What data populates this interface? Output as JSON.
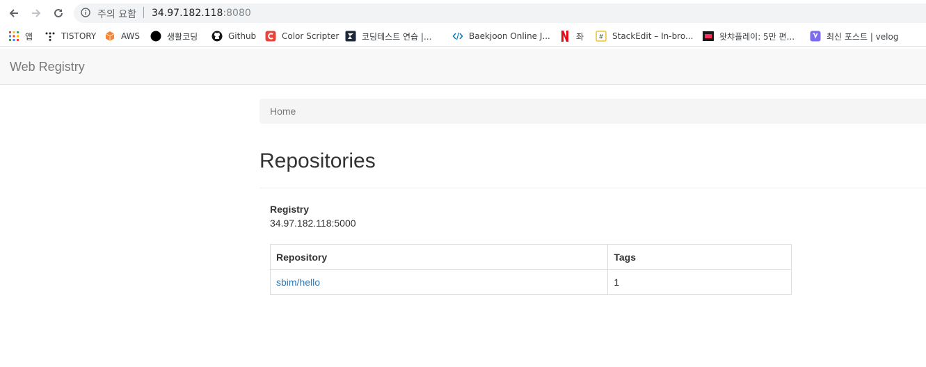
{
  "browser": {
    "security_warning": "주의 요함",
    "url_host": "34.97.182.118",
    "url_port": ":8080",
    "bookmarks": [
      {
        "label": "앱",
        "icon": "apps-grid-icon"
      },
      {
        "label": "TISTORY",
        "icon": "tistory-icon"
      },
      {
        "label": "AWS",
        "icon": "aws-cube-icon"
      },
      {
        "label": "생활코딩",
        "icon": "black-circle-icon"
      },
      {
        "label": "Github",
        "icon": "github-icon"
      },
      {
        "label": "Color Scripter",
        "icon": "color-scripter-icon"
      },
      {
        "label": "코딩테스트 연습 |...",
        "icon": "programmers-icon"
      },
      {
        "label": "Baekjoon Online J...",
        "icon": "code-brackets-icon"
      },
      {
        "label": "좌",
        "icon": "netflix-icon"
      },
      {
        "label": "StackEdit – In-bro...",
        "icon": "stackedit-icon"
      },
      {
        "label": "왓챠플레이: 5만 편...",
        "icon": "watcha-icon"
      },
      {
        "label": "최신 포스트 | velog",
        "icon": "velog-icon"
      }
    ]
  },
  "navbar": {
    "brand": "Web Registry"
  },
  "breadcrumb": {
    "home": "Home"
  },
  "main": {
    "title": "Repositories",
    "registry_label": "Registry",
    "registry_value": "34.97.182.118:5000",
    "table": {
      "headers": [
        "Repository",
        "Tags"
      ],
      "rows": [
        {
          "repository": "sbim/hello",
          "tags": "1"
        }
      ]
    }
  },
  "colors": {
    "link": "#337ab7",
    "navbar_bg": "#f8f8f8",
    "breadcrumb_bg": "#f5f5f5"
  }
}
